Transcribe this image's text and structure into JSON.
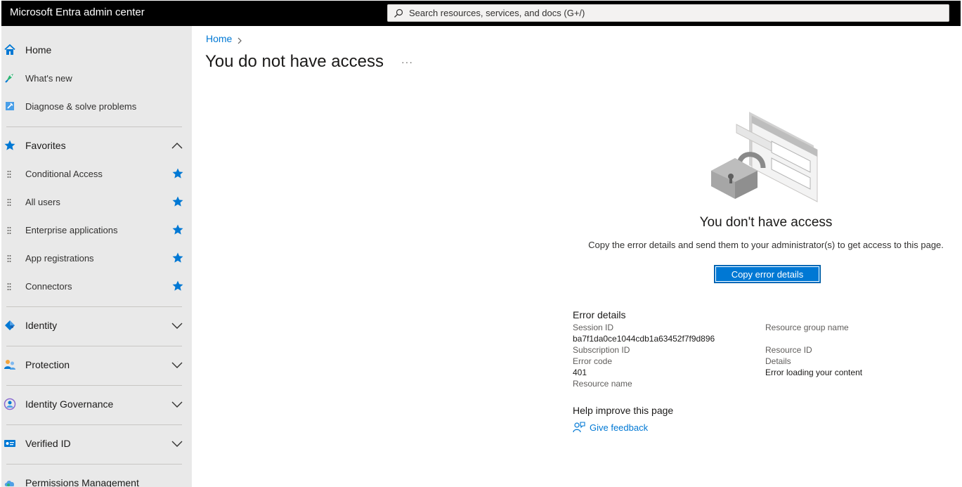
{
  "app": {
    "title": "Microsoft Entra admin center",
    "search_placeholder": "Search resources, services, and docs (G+/)"
  },
  "sidebar": {
    "top_items": [
      {
        "label": "Home",
        "icon": "home-icon"
      },
      {
        "label": "What's new",
        "icon": "rocket-icon"
      },
      {
        "label": "Diagnose & solve problems",
        "icon": "wrench-icon"
      }
    ],
    "favorites": {
      "label": "Favorites",
      "icon": "star-icon",
      "expanded": true,
      "items": [
        {
          "label": "Conditional Access"
        },
        {
          "label": "All users"
        },
        {
          "label": "Enterprise applications"
        },
        {
          "label": "App registrations"
        },
        {
          "label": "Connectors"
        }
      ]
    },
    "sections": [
      {
        "label": "Identity",
        "icon": "identity-diamond-icon"
      },
      {
        "label": "Protection",
        "icon": "protection-people-icon"
      },
      {
        "label": "Identity Governance",
        "icon": "governance-icon"
      },
      {
        "label": "Verified ID",
        "icon": "id-card-icon"
      },
      {
        "label": "Permissions Management",
        "icon": "cloud-icon"
      }
    ]
  },
  "main": {
    "breadcrumb": [
      "Home"
    ],
    "page_title": "You do not have access",
    "more_label": "···",
    "error": {
      "title": "You don't have access",
      "message": "Copy the error details and send them to your administrator(s) to get access to this page.",
      "copy_button": "Copy error details"
    },
    "details": {
      "heading": "Error details",
      "session_id_label": "Session ID",
      "session_id_value": "ba7f1da0ce1044cdb1a63452f7f9d896",
      "subscription_id_label": "Subscription ID",
      "error_code_label": "Error code",
      "error_code_value": "401",
      "resource_name_label": "Resource name",
      "resource_group_label": "Resource group name",
      "resource_id_label": "Resource ID",
      "details_label": "Details",
      "details_value": "Error loading your content"
    },
    "help": {
      "heading": "Help improve this page",
      "feedback_label": "Give feedback"
    }
  },
  "colors": {
    "accent": "#0078d4",
    "topbar": "#000000",
    "sidebar": "#e9e9e9"
  }
}
